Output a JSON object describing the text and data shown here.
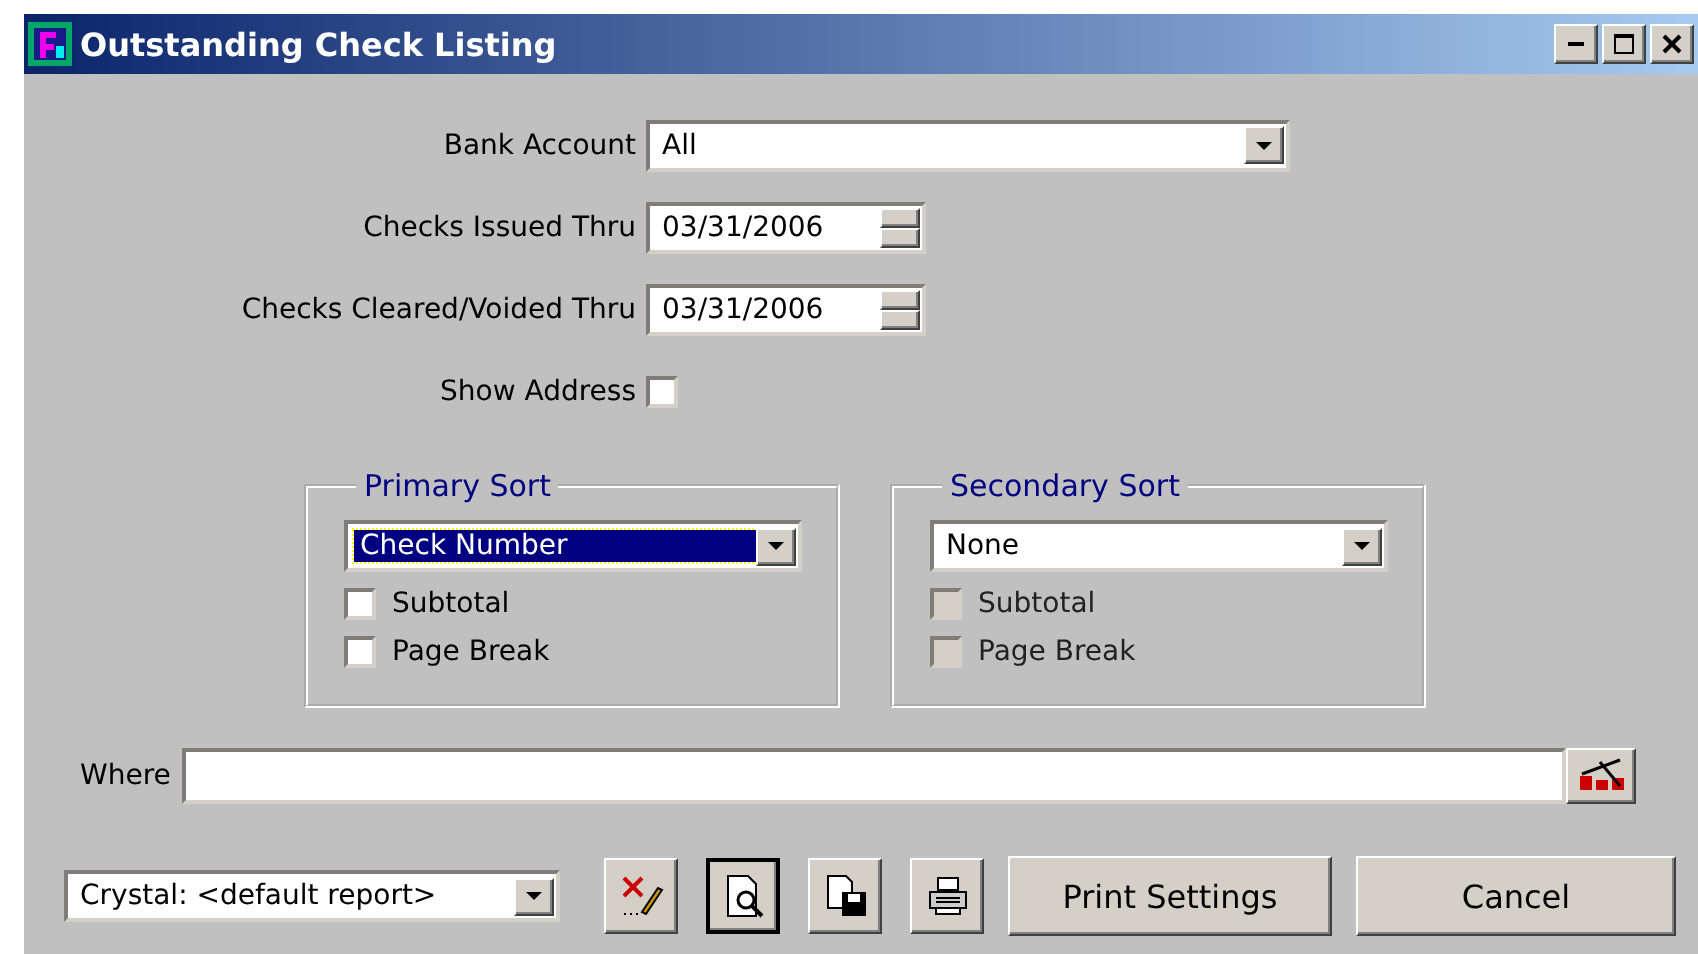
{
  "window": {
    "title": "Outstanding Check Listing"
  },
  "fields": [
    {
      "kind": "dropdown",
      "label": "Bank Account",
      "value": "All"
    },
    {
      "kind": "date",
      "label": "Checks Issued Thru",
      "value": "03/31/2006"
    },
    {
      "kind": "date",
      "label": "Checks Cleared/Voided Thru",
      "value": "03/31/2006"
    },
    {
      "kind": "checkbox",
      "label": "Show Address",
      "checked": false
    }
  ],
  "sorts": [
    {
      "title": "Primary Sort",
      "value": "Check Number",
      "focused": true,
      "options": [
        {
          "label": "Subtotal",
          "checked": false,
          "disabled": false
        },
        {
          "label": "Page Break",
          "checked": false,
          "disabled": false
        }
      ]
    },
    {
      "title": "Secondary Sort",
      "value": "None",
      "focused": false,
      "options": [
        {
          "label": "Subtotal",
          "checked": false,
          "disabled": true
        },
        {
          "label": "Page Break",
          "checked": false,
          "disabled": true
        }
      ]
    }
  ],
  "where": {
    "label": "Where"
  },
  "report": {
    "value": "Crystal: <default report>"
  },
  "buttons": [
    {
      "label": "Print Settings"
    },
    {
      "label": "Cancel"
    }
  ]
}
